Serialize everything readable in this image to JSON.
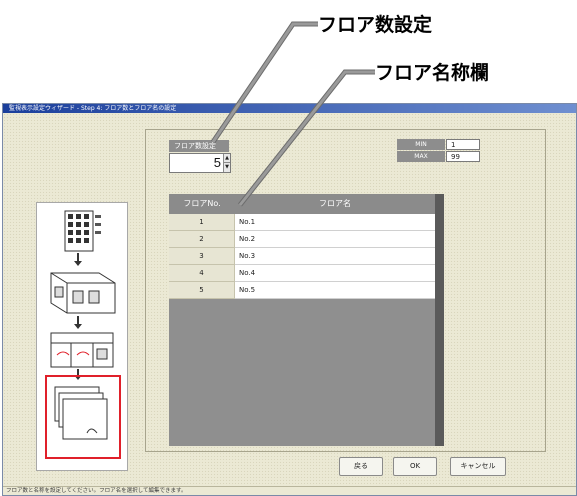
{
  "callouts": {
    "floor_count": "フロア数設定",
    "floor_name_column": "フロア名称欄"
  },
  "window": {
    "title": "監視表示設定ウィザード - Step 4: フロア数とフロア名の設定",
    "status_text": "フロア数と名称を設定してください。フロア名を選択して編集できます。"
  },
  "floor_count": {
    "label": "フロア数設定",
    "value": "5"
  },
  "range": {
    "min_label": "MIN",
    "min_value": "1",
    "max_label": "MAX",
    "max_value": "99"
  },
  "table": {
    "headers": [
      "フロアNo.",
      "フロア名"
    ],
    "rows": [
      {
        "no": "1",
        "name": "No.1"
      },
      {
        "no": "2",
        "name": "No.2"
      },
      {
        "no": "3",
        "name": "No.3"
      },
      {
        "no": "4",
        "name": "No.4"
      },
      {
        "no": "5",
        "name": "No.5"
      }
    ]
  },
  "buttons": {
    "back": "戻る",
    "ok": "OK",
    "cancel": "キャンセル"
  },
  "colors": {
    "selection_frame": "#e0202a",
    "titlebar": "#1b3f9c"
  }
}
